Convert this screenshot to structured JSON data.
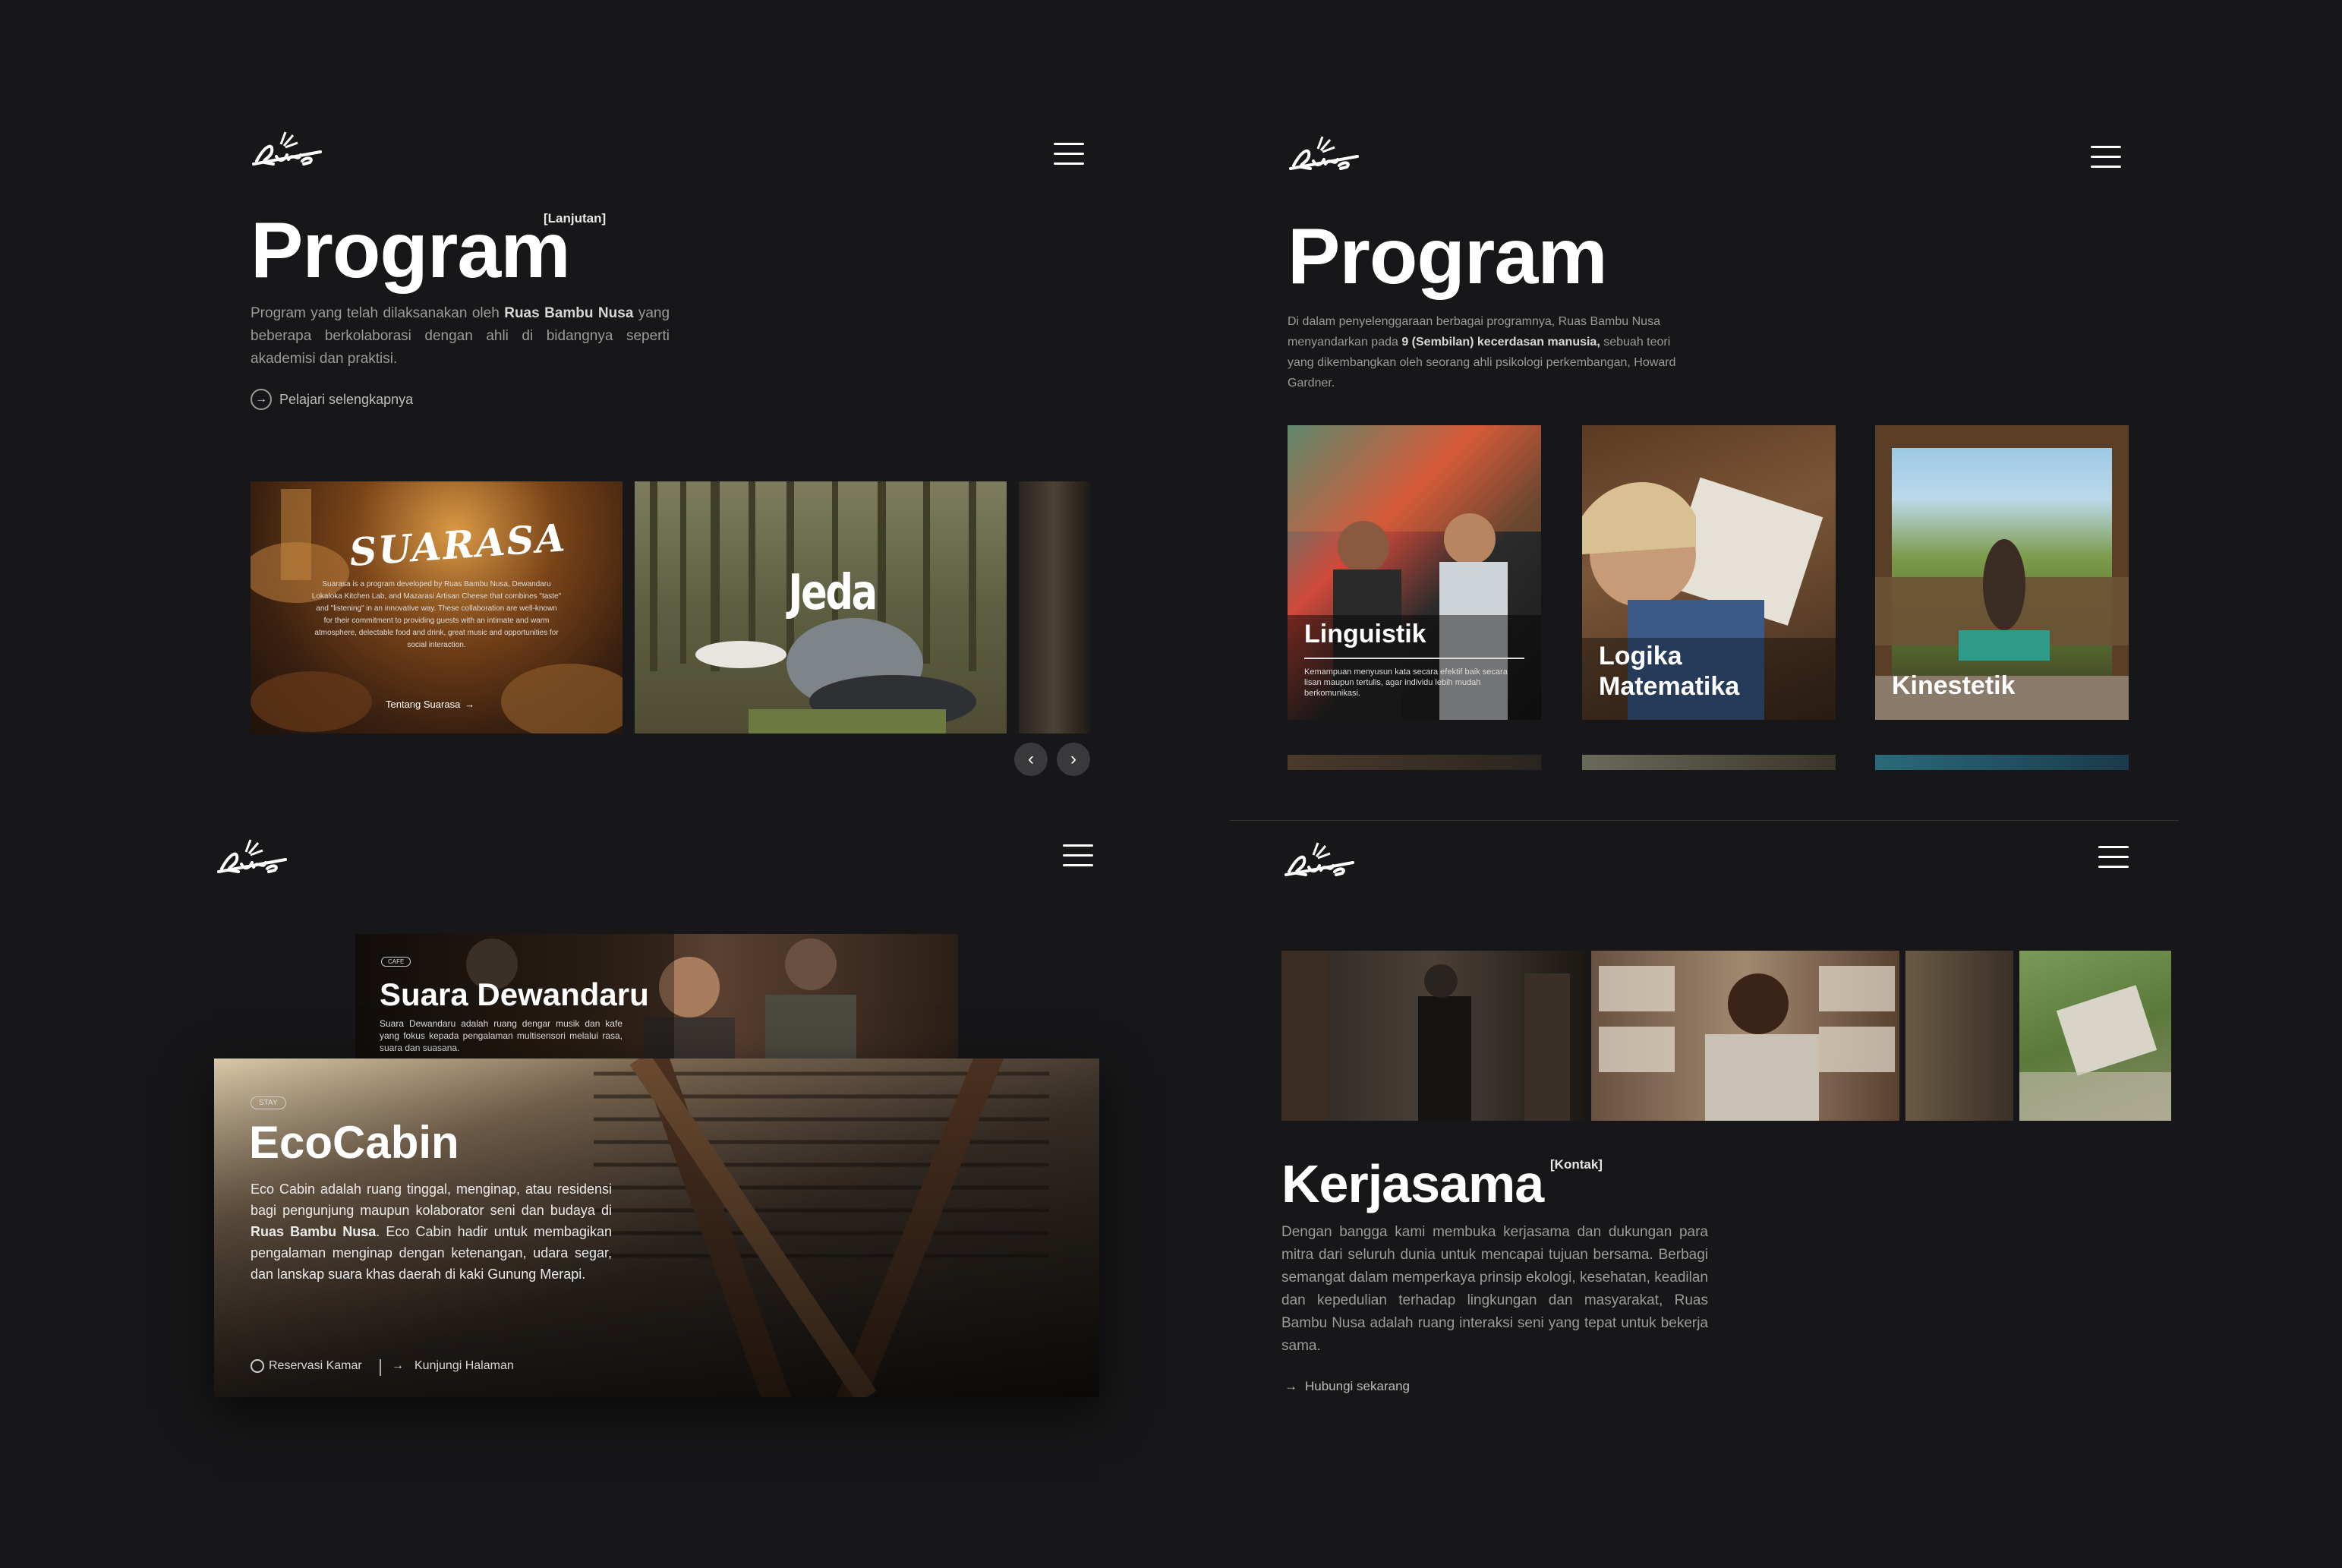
{
  "colors": {
    "background": "#171618",
    "panel": "#121113",
    "muted": "#9b9b9b"
  },
  "p1": {
    "title": "Program",
    "tag": "[Lanjutan]",
    "desc_pre": "Program yang telah dilaksanakan oleh ",
    "desc_bold": "Ruas Bambu Nusa",
    "desc_post": " yang beberapa berkolaborasi dengan ahli di bidangnya seperti akademisi dan praktisi.",
    "link": "Pelajari selengkapnya",
    "suarasa": {
      "title": "SUARASA",
      "text": "Suarasa is a program developed by Ruas Bambu Nusa, Dewandaru Lokaloka Kitchen Lab, and Mazarasi Artisan Cheese that combines \"taste\" and \"listening\" in an innovative way. These collaboration are well-known for their commitment to providing guests with an intimate and warm atmosphere, delectable food and drink, great music and opportunities for social interaction.",
      "link": "Tentang Suarasa"
    },
    "jeda": {
      "title": "Jeda"
    }
  },
  "p2": {
    "title": "Program",
    "desc_pre": "Di dalam penyelenggaraan berbagai programnya, Ruas Bambu Nusa menyandarkan pada ",
    "desc_bold": "9 (Sembilan) kecerdasan manusia,",
    "desc_post": " sebuah teori yang dikembangkan oleh seorang ahli psikologi perkembangan, Howard Gardner.",
    "cards": [
      {
        "title": "Linguistik",
        "text": "Kemampuan menyusun kata secara efektif baik secara lisan maupun tertulis, agar individu lebih mudah berkomunikasi."
      },
      {
        "title": "Logika Matematika"
      },
      {
        "title": "Kinestetik"
      }
    ]
  },
  "p3": {
    "dewandaru": {
      "badge": "CAFE",
      "title": "Suara Dewandaru",
      "text": "Suara Dewandaru adalah ruang dengar musik dan kafe yang fokus kepada pengalaman multisensori melalui rasa, suara dan suasana."
    },
    "ecocabin": {
      "badge": "STAY",
      "title": "EcoCabin",
      "text_pre": "Eco Cabin adalah ruang tinggal, menginap, atau residensi bagi pengunjung maupun kolaborator seni dan budaya di ",
      "text_bold": "Ruas Bambu Nusa",
      "text_post": ". Eco Cabin hadir untuk membagikan pengalaman menginap dengan ketenangan, udara segar, dan lanskap suara khas daerah di kaki Gunung Merapi.",
      "link1": "Reservasi Kamar",
      "link2": "Kunjungi Halaman"
    }
  },
  "p4": {
    "title": "Kerjasama",
    "tag": "[Kontak]",
    "desc": "Dengan bangga kami membuka kerjasama dan dukungan para mitra dari seluruh dunia untuk mencapai tujuan bersama. Berbagi semangat dalam memperkaya prinsip ekologi, kesehatan, keadilan dan kepedulian terhadap lingkungan dan masyarakat, Ruas Bambu Nusa adalah ruang interaksi seni yang tepat untuk bekerja sama.",
    "link": "Hubungi sekarang"
  }
}
